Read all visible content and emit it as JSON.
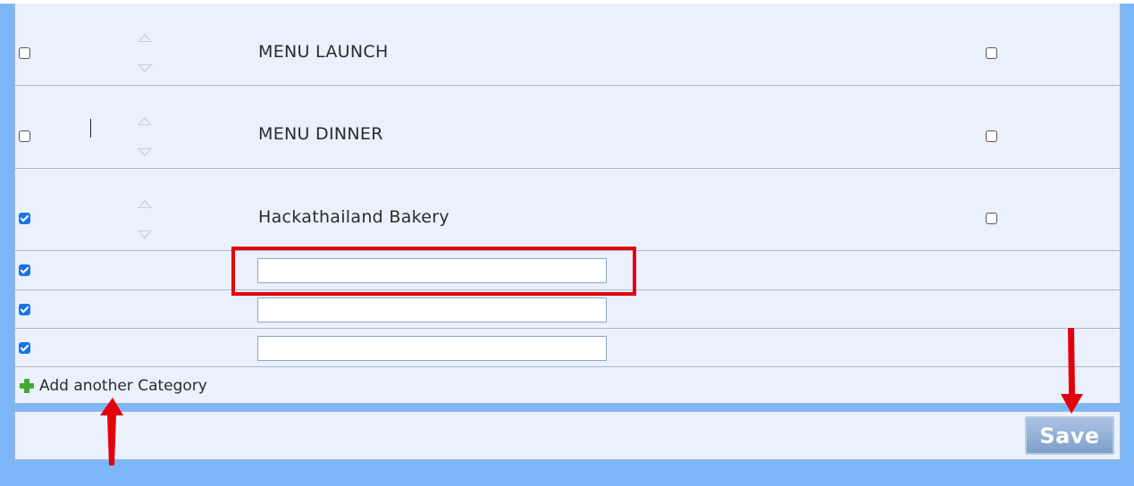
{
  "categories": [
    {
      "name": "MENU LAUNCH",
      "checked": false,
      "flag_checked": false
    },
    {
      "name": "MENU DINNER",
      "checked": false,
      "flag_checked": false
    },
    {
      "name": "Hackathailand Bakery",
      "checked": true,
      "flag_checked": false
    }
  ],
  "new_rows": [
    {
      "checked": true,
      "value": ""
    },
    {
      "checked": true,
      "value": ""
    },
    {
      "checked": true,
      "value": ""
    }
  ],
  "add_link": {
    "label": "Add another Category",
    "icon": "plus-icon"
  },
  "save_button": {
    "label": "Save"
  },
  "annotation_colors": {
    "highlight": "#e3000b",
    "arrows": "#e3000b"
  }
}
